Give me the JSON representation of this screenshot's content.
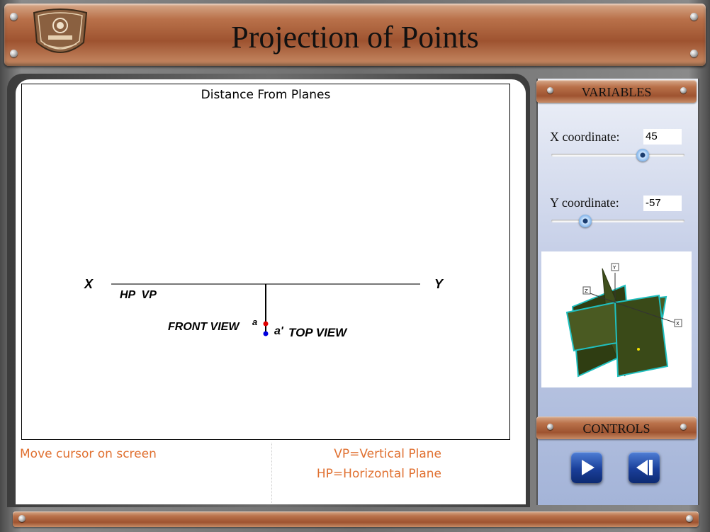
{
  "header": {
    "title": "Projection of Points"
  },
  "canvas": {
    "title": "Distance From Planes",
    "labels": {
      "x": "X",
      "y": "Y",
      "hp_vp": "HP  VP",
      "front_view": "FRONT VIEW",
      "a": "a",
      "a_prime": "a'",
      "top_view": "TOP VIEW"
    }
  },
  "notes": {
    "instruction": "Move cursor on screen",
    "vp": "VP=Vertical Plane",
    "hp": "HP=Horizontal Plane"
  },
  "variables": {
    "heading": "VARIABLES",
    "x": {
      "label": "X coordinate:",
      "value": "45"
    },
    "y": {
      "label": "Y coordinate:",
      "value": "-57"
    }
  },
  "preview": {
    "axis_x": "X",
    "axis_y": "Y",
    "axis_z": "Z"
  },
  "controls": {
    "heading": "CONTROLS"
  },
  "colors": {
    "accent": "#e07030",
    "point_a": "#e00000",
    "point_a_prime": "#0000e0",
    "plane": "#3f4f1c",
    "plane_edge": "#20c0c0"
  }
}
